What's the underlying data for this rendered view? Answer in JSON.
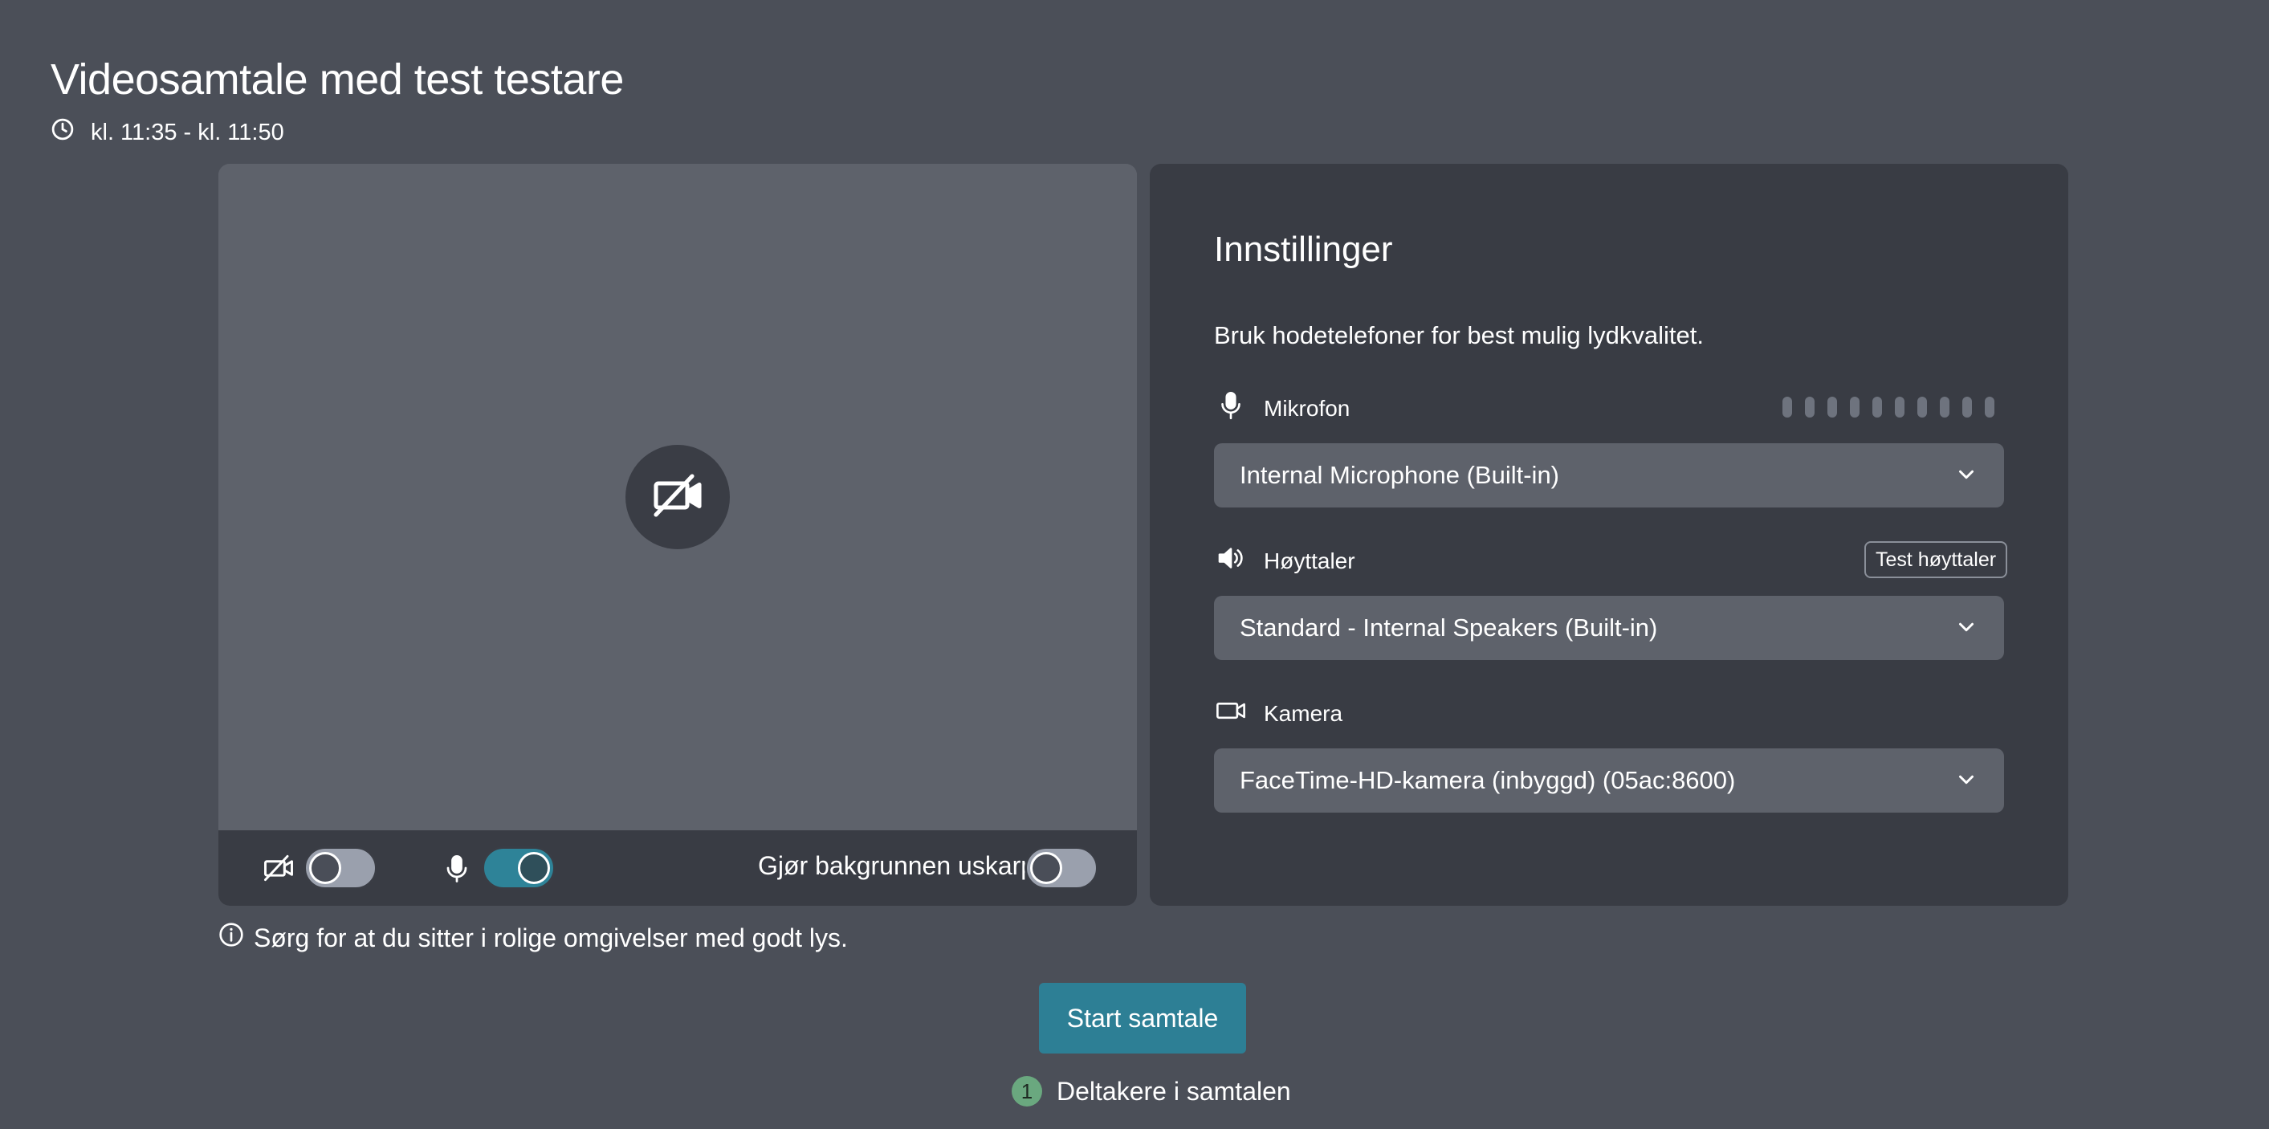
{
  "header": {
    "title": "Videosamtale med test testare",
    "time": "kl. 11:35 - kl. 11:50"
  },
  "video": {
    "blur_label": "Gjør bakgrunnen uskarp",
    "camera_enabled": false,
    "microphone_enabled": true,
    "blur_enabled": false
  },
  "info": {
    "text": "Sørg for at du sitter i rolige omgivelser med godt lys."
  },
  "settings": {
    "title": "Innstillinger",
    "hint": "Bruk hodetelefoner for best mulig lydkvalitet.",
    "microphone": {
      "label": "Mikrofon",
      "selected": "Internal Microphone (Built-in)",
      "level_segments": 10,
      "level_active": 0
    },
    "speaker": {
      "label": "Høyttaler",
      "selected": "Standard - Internal Speakers (Built-in)",
      "test_label": "Test høyttaler"
    },
    "camera": {
      "label": "Kamera",
      "selected": "FaceTime-HD-kamera (inbyggd) (05ac:8600)"
    }
  },
  "actions": {
    "start_label": "Start samtale"
  },
  "participants": {
    "count": "1",
    "label": "Deltakere i samtalen"
  },
  "colors": {
    "background": "#4b4f58",
    "panel": "#393c44",
    "accent": "#2d7f95",
    "badge": "#6aa87f"
  }
}
